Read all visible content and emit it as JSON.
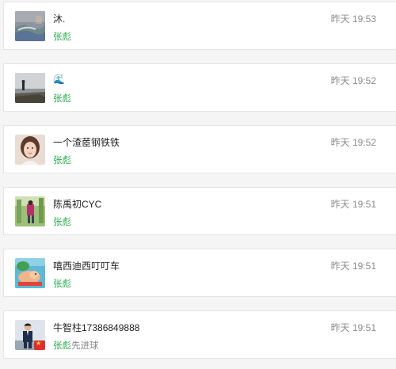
{
  "items": [
    {
      "name": "沐.",
      "author": "张彪",
      "status": "",
      "time": "昨天 19:53",
      "avatar_icon": "landscape-avatar-icon"
    },
    {
      "name": "🌊",
      "author": "张彪",
      "status": "",
      "time": "昨天 19:52",
      "avatar_icon": "beach-avatar-icon"
    },
    {
      "name": "一个渣茝钢铁铁",
      "author": "张彪",
      "status": "",
      "time": "昨天 19:52",
      "avatar_icon": "portrait-avatar-icon"
    },
    {
      "name": "陈禹初CYC",
      "author": "张彪",
      "status": "",
      "time": "昨天 19:51",
      "avatar_icon": "outdoor-avatar-icon"
    },
    {
      "name": "嘻西迪西叮叮车",
      "author": "张彪",
      "status": "",
      "time": "昨天 19:51",
      "avatar_icon": "cartoon-avatar-icon"
    },
    {
      "name": "牛智柱17386849888",
      "author": "张彪",
      "status": "先进球",
      "time": "昨天 19:51",
      "avatar_icon": "suit-avatar-icon",
      "badge_icon": "flag-icon"
    }
  ],
  "colors": {
    "author": "#2eaa52",
    "time": "#8c8c8c",
    "name": "#222222"
  }
}
